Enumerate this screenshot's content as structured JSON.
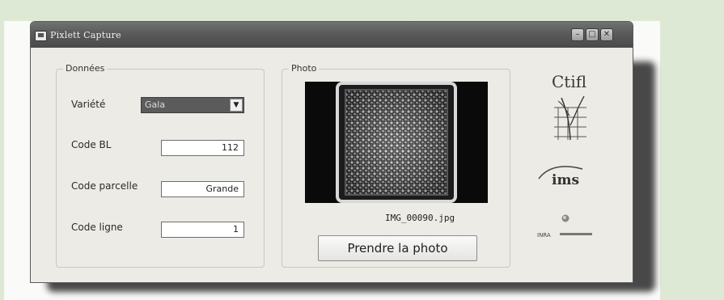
{
  "window": {
    "title": "Pixlett Capture"
  },
  "donnees": {
    "legend": "Données",
    "variete": {
      "label": "Variété",
      "value": "Gala"
    },
    "code_bl": {
      "label": "Code BL",
      "value": "112"
    },
    "code_parcelle": {
      "label": "Code parcelle",
      "value": "Grande"
    },
    "code_ligne": {
      "label": "Code ligne",
      "value": "1"
    }
  },
  "photo": {
    "legend": "Photo",
    "filename": "IMG_00090.jpg",
    "button_label": "Prendre la photo"
  },
  "logos": {
    "ctifl": "Ctifl",
    "ims": "ims",
    "inra": "INRA"
  }
}
